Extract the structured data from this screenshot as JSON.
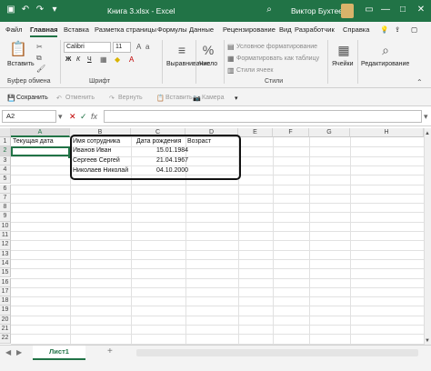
{
  "window": {
    "title": "Книга 3.xlsx  -  Excel",
    "user": "Виктор Бухтеев",
    "search_icon": "search-icon",
    "minimize": "—",
    "maximize": "□",
    "close": "✕"
  },
  "tabs": [
    "Файл",
    "Главная",
    "Вставка",
    "Разметка страницы",
    "Формулы",
    "Данные",
    "Рецензирование",
    "Вид",
    "Разработчик",
    "Справка"
  ],
  "active_tab": "Главная",
  "ribbon": {
    "paste_label": "Вставить",
    "clipboard_group": "Буфер обмена",
    "font_name": "Calibri",
    "font_size": "11",
    "font_group": "Шрифт",
    "bold": "Ж",
    "italic": "К",
    "underline": "Ч",
    "alignment_label": "Выравнивание",
    "number_label": "Число",
    "cond_format": "Условное форматирование",
    "format_table": "Форматировать как таблицу",
    "cell_styles": "Стили ячеек",
    "styles_group": "Стили",
    "cells_label": "Ячейки",
    "editing_label": "Редактирование"
  },
  "qat": {
    "save": "Сохранить",
    "undo": "Отменить",
    "redo": "Вернуть",
    "paste": "Вставить",
    "camera": "Камера"
  },
  "formula_bar": {
    "name_box": "A2",
    "value": ""
  },
  "columns": [
    "A",
    "B",
    "C",
    "D",
    "E",
    "F",
    "G",
    "H"
  ],
  "rows": [
    "1",
    "2",
    "3",
    "4",
    "5",
    "6",
    "7",
    "8",
    "9",
    "10",
    "11",
    "12",
    "13",
    "14",
    "15",
    "16",
    "17",
    "18",
    "19",
    "20",
    "21",
    "22"
  ],
  "cells": {
    "A1": "Текущая дата",
    "B1": "Имя сотрудника",
    "C1": "Дата рождения",
    "D1": "Возраст",
    "B2": "Иванов Иван",
    "C2": "15.01.1984",
    "B3": "Сергеев Сергей",
    "C3": "21.04.1967",
    "B4": "Николаев Николай",
    "C4": "04.10.2000"
  },
  "sheet": {
    "tab": "Лист1",
    "add": "+"
  },
  "colors": {
    "accent": "#217346",
    "ribbon_bg": "#f3f3f3"
  }
}
